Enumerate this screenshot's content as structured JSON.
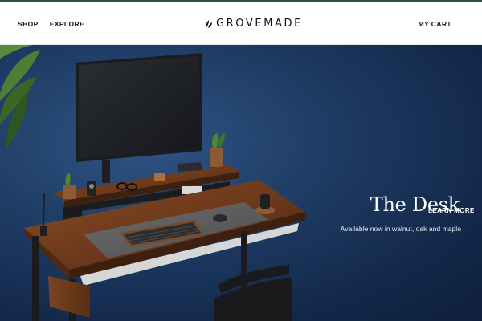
{
  "header": {
    "nav": [
      {
        "label": "SHOP"
      },
      {
        "label": "EXPLORE"
      }
    ],
    "logo_text": "GROVEMADE",
    "cart_label": "MY CART"
  },
  "hero": {
    "title": "The Desk",
    "subtitle": "Available now in walnut, oak and maple",
    "cta_label": "LEARN MORE"
  },
  "colors": {
    "top_strip": "#2f4f4f",
    "hero_background": "#1e3b63",
    "text_dark": "#111111",
    "text_light": "#ffffff"
  },
  "icons": [
    "grovemade-leaf-logo"
  ]
}
